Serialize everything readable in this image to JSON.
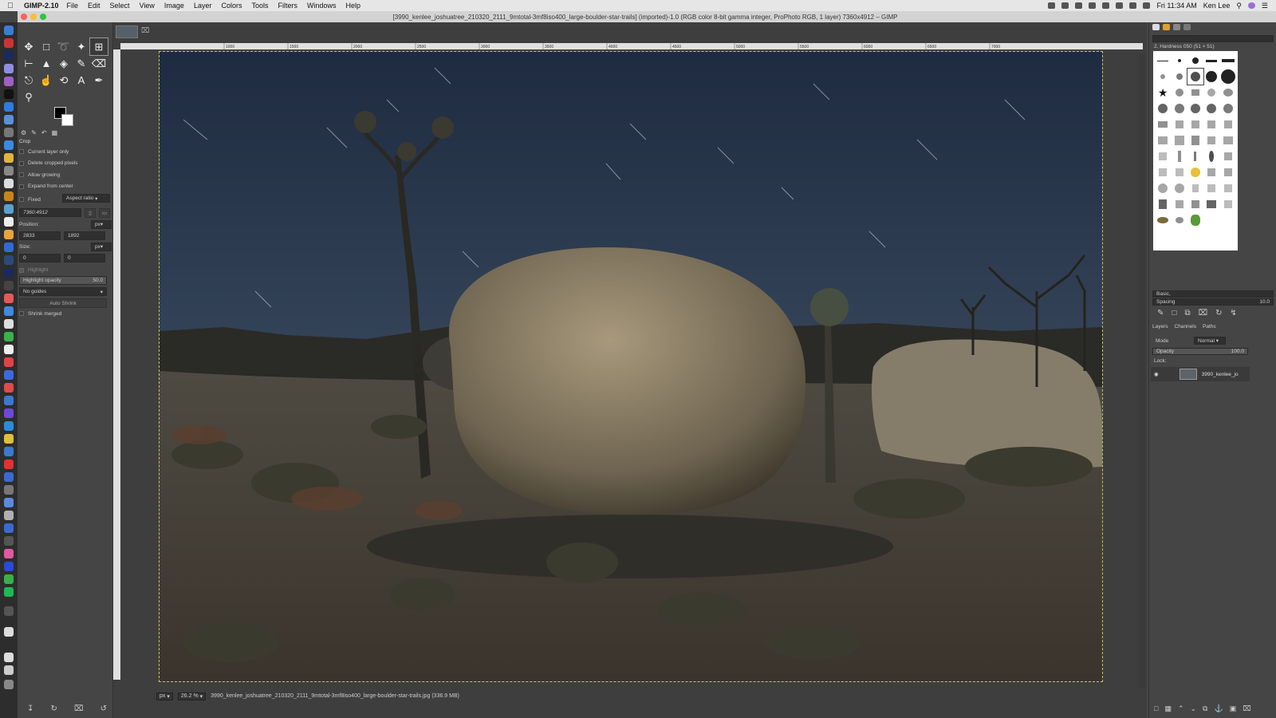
{
  "menubar": {
    "app": "GIMP-2.10",
    "items": [
      "File",
      "Edit",
      "Select",
      "View",
      "Image",
      "Layer",
      "Colors",
      "Tools",
      "Filters",
      "Windows",
      "Help"
    ],
    "clock": "Fri 11:34 AM",
    "user": "Ken Lee"
  },
  "window": {
    "title": "[3990_kenlee_joshuatree_210320_2111_9mtotal-3mf8iso400_large-boulder-star-trails] (imported)-1.0 (RGB color 8-bit gamma integer, ProPhoto RGB, 1 layer) 7360x4912 – GIMP"
  },
  "tool_options": {
    "header": "Crop",
    "current_layer_only": "Current layer only",
    "delete_cropped_pixels": "Delete cropped pixels",
    "allow_growing": "Allow growing",
    "expand_from_center": "Expand from center",
    "fixed": "Fixed",
    "aspect_ratio": "Aspect ratio",
    "ratio_value": "7360:4912",
    "position_label": "Position:",
    "position_unit": "px",
    "position_x": "2833",
    "position_y": "1892",
    "size_label": "Size:",
    "size_unit": "px",
    "size_w": "0",
    "size_h": "0",
    "highlight": "Highlight",
    "highlight_opacity": "Highlight opacity",
    "highlight_opacity_value": "50.0",
    "guides": "No guides",
    "auto_shrink": "Auto Shrink",
    "shrink_merged": "Shrink merged"
  },
  "brushes": {
    "selected": "2. Hardness 050 (51 × 51)",
    "preset": "Basic,",
    "spacing_label": "Spacing",
    "spacing_value": "10.0"
  },
  "layers": {
    "tabs": [
      "Layers",
      "Channels",
      "Paths"
    ],
    "mode_label": "Mode",
    "mode_value": "Normal",
    "opacity_label": "Opacity",
    "opacity_value": "100.0",
    "lock_label": "Lock:",
    "layer_name": "3990_kenlee_jo"
  },
  "status": {
    "unit": "px",
    "zoom": "26.2 %",
    "filename": "3990_kenlee_joshuatree_210320_2111_9mtotal-3mf8iso400_large-boulder-star-trails.jpg (336.9 MB)"
  },
  "ruler_ticks": [
    "1000",
    "1500",
    "2000",
    "2500",
    "3000",
    "3500",
    "4000",
    "4500",
    "5000",
    "5500",
    "6000",
    "6500",
    "7000"
  ]
}
